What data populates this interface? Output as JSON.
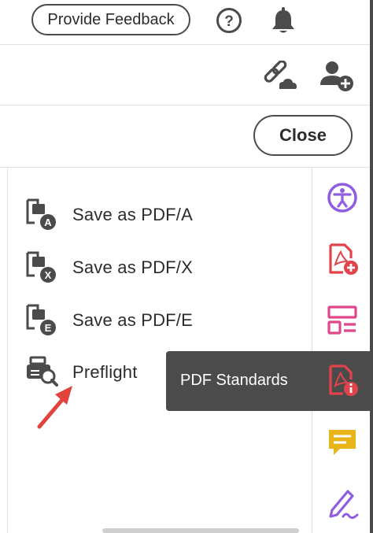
{
  "header": {
    "feedback_label": "Provide Feedback",
    "help_icon": "help-circle-icon",
    "notifications_icon": "bell-icon"
  },
  "toolbar": {
    "share_link_icon": "link-cloud-icon",
    "add_user_icon": "add-user-icon"
  },
  "panel": {
    "close_label": "Close",
    "items": [
      {
        "label": "Save as PDF/A",
        "icon": "pdf-a-icon",
        "badge": "A"
      },
      {
        "label": "Save as PDF/X",
        "icon": "pdf-x-icon",
        "badge": "X"
      },
      {
        "label": "Save as PDF/E",
        "icon": "pdf-e-icon",
        "badge": "E"
      },
      {
        "label": "Preflight",
        "icon": "preflight-icon"
      }
    ]
  },
  "tooltip": {
    "text": "PDF Standards"
  },
  "right_rail": {
    "icons": [
      {
        "name": "accessibility-icon",
        "color": "#8f5ee0"
      },
      {
        "name": "create-pdf-icon",
        "color": "#e0434c"
      },
      {
        "name": "organize-pages-icon",
        "color": "#e0468a"
      },
      {
        "name": "pdf-standards-icon",
        "color": "#e0434c"
      },
      {
        "name": "comment-icon",
        "color": "#e8b418"
      },
      {
        "name": "fill-sign-icon",
        "color": "#8f5ee0"
      }
    ]
  },
  "colors": {
    "annotation_arrow": "#e0443c",
    "tooltip_bg": "#4b4b4b"
  }
}
